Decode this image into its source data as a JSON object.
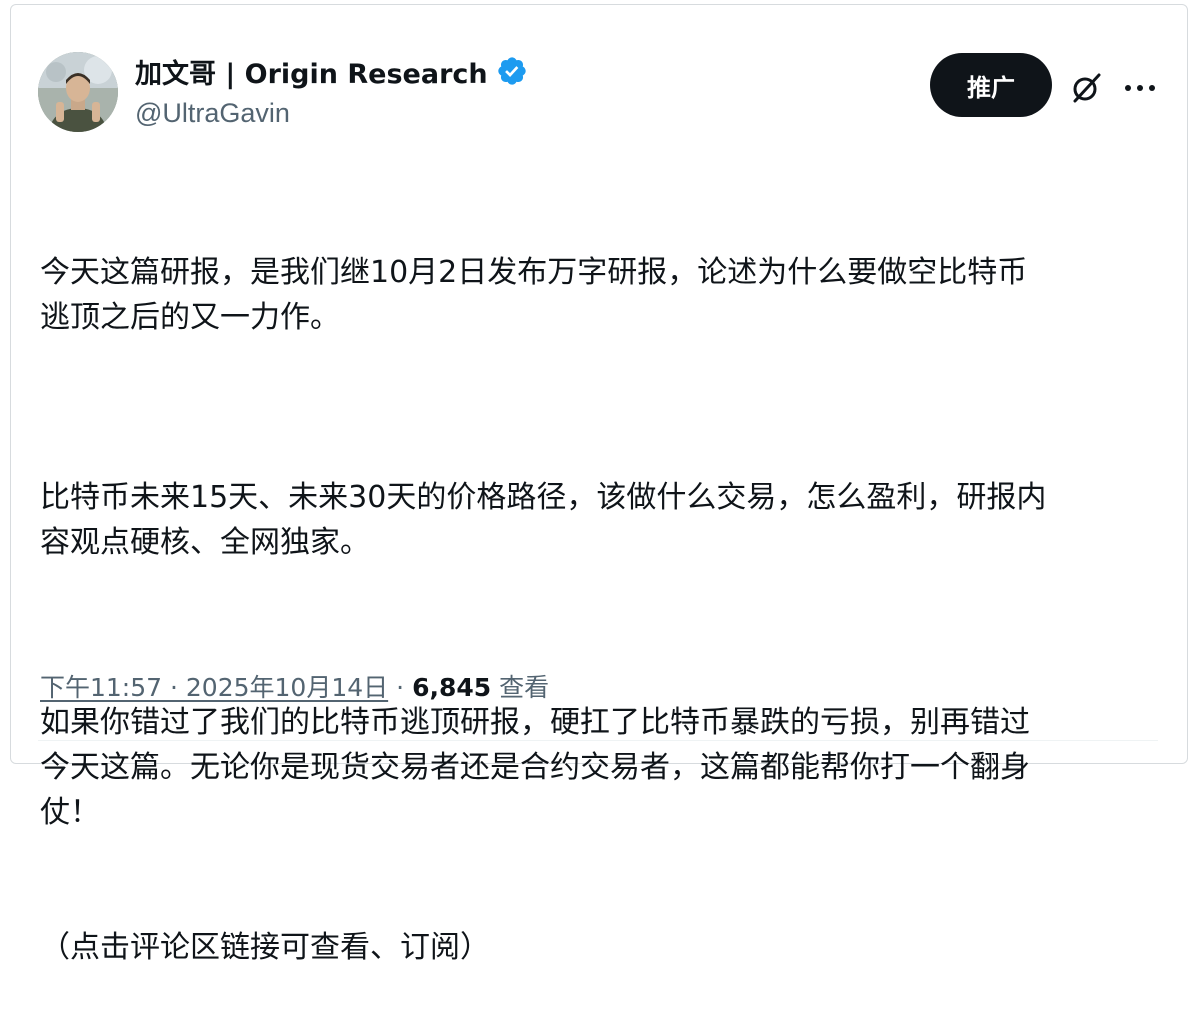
{
  "author": {
    "display_name": "加文哥 | Origin Research",
    "handle": "@UltraGavin",
    "verified": true,
    "verified_color": "#1d9bf0"
  },
  "actions": {
    "promote_label": "推广",
    "grok_icon": "grok-icon",
    "more_icon": "more-horizontal-icon"
  },
  "tweet": {
    "paragraphs": [
      "今天这篇研报，是我们继10月2日发布万字研报，论述为什么要做空比特币\n逃顶之后的又一力作。",
      "比特币未来15天、未来30天的价格路径，该做什么交易，怎么盈利，研报内\n容观点硬核、全网独家。",
      "如果你错过了我们的比特币逃顶研报，硬扛了比特币暴跌的亏损，别再错过\n今天这篇。无论你是现货交易者还是合约交易者，这篇都能帮你打一个翻身\n仗！",
      "（点击评论区链接可查看、订阅）"
    ]
  },
  "meta": {
    "timestamp": "下午11:57 · 2025年10月14日",
    "separator": "·",
    "views_count": "6,845",
    "views_label": "查看"
  },
  "colors": {
    "text_primary": "#0f1419",
    "text_secondary": "#536471",
    "button_bg": "#0f1419",
    "button_text": "#ffffff"
  }
}
